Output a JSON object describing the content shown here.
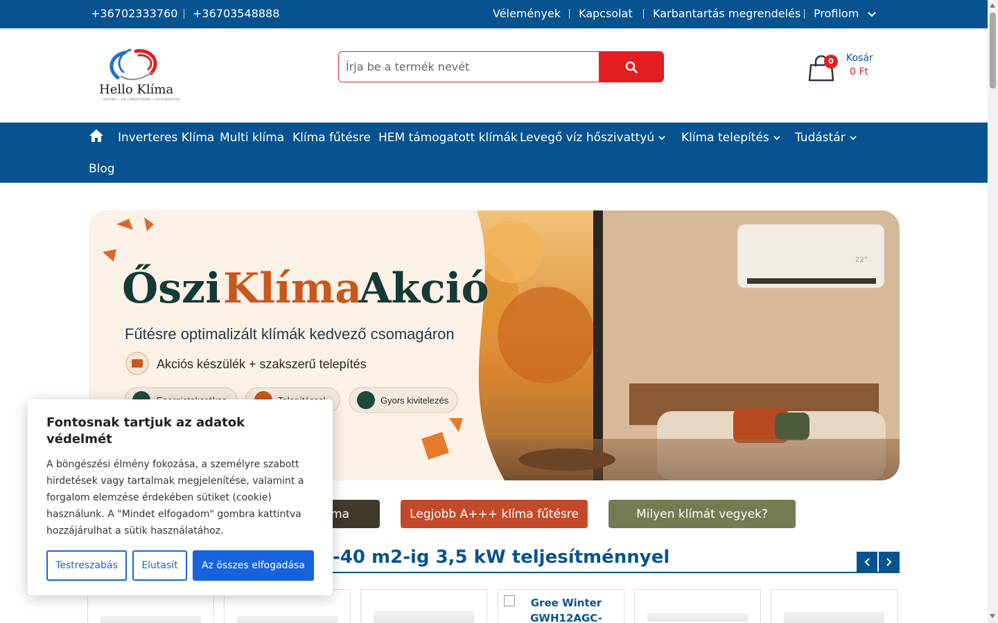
{
  "topbar": {
    "phone1": "+36702333760",
    "phone2": "+36703548888",
    "links": [
      "Vélemények",
      "Kapcsolat",
      "Karbantartás megrendelés",
      "Profilom"
    ]
  },
  "brand": {
    "logo_text": "Hello Klíma",
    "logo_sub": "HEATING • AIR CONDITIONING • REFRIGERATION"
  },
  "search": {
    "placeholder": "Írja be a termék nevét"
  },
  "cart": {
    "count": "0",
    "label": "Kosár",
    "total": "0 Ft"
  },
  "nav": {
    "items": [
      "Inverteres Klíma",
      "Multi klíma",
      "Klíma fűtésre",
      "HEM támogatott klímák",
      "Levegő víz hőszivattyú",
      "Klíma telepítés",
      "Tudástár",
      "Blog"
    ]
  },
  "banner": {
    "title_1": "Őszi",
    "title_2": "Klíma",
    "title_3": "Akció",
    "subtitle": "Fűtésre optimalizált klímák kedvező csomagáron",
    "line": "Akciós készülék + szakszerű telepítés",
    "badges": [
      "Energiatakarékos",
      "Telepítéssel",
      "Gyors kivitelezés"
    ],
    "display": "22°"
  },
  "buttons": {
    "b1": "ma",
    "b2": "Legjobb A+++ klíma fűtésre",
    "b3": "Milyen klímát vegyek?"
  },
  "section": {
    "title": "-40 m2-ig 3,5 kW teljesítménnyel",
    "card_alt": "Gree Winter GWH12AGC-"
  },
  "cookie": {
    "title": "Fontosnak tartjuk az adatok védelmét",
    "text": "A böngészési élmény fokozása, a személyre szabott hirdetések vagy tartalmak megjelenítése, valamint a forgalom elemzése érdekében sütiket (cookie) használunk. A \"Mindet elfogadom\" gombra kattintva hozzájárulhat a sütik használatához.",
    "customize": "Testreszabás",
    "reject": "Elutasít",
    "accept_all": "Az összes elfogadása"
  },
  "colors": {
    "primary": "#08538f",
    "accent_red": "#e31e1e",
    "cookie_blue": "#1863dc",
    "btn_dark": "#3f3a2a",
    "btn_rust": "#c24a2a",
    "btn_olive": "#767a52"
  }
}
